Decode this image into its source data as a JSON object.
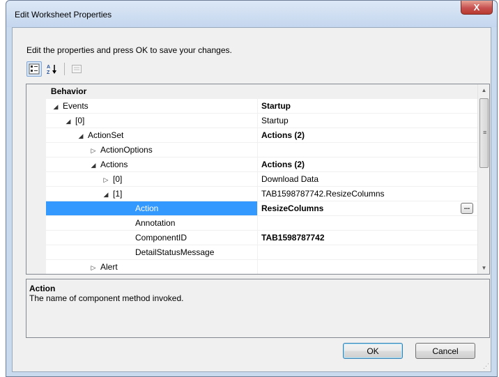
{
  "window": {
    "title": "Edit Worksheet Properties",
    "close_label": "X"
  },
  "instruction": "Edit the properties and press OK to save your changes.",
  "toolbar": {
    "categorized_icon": "categorized-icon",
    "alphabetical_icon": "alphabetical-icon",
    "alphabetical_label": "A↓Z",
    "property_pages_icon": "property-pages-icon"
  },
  "grid": {
    "rows": [
      {
        "name": "Behavior",
        "value": "",
        "glyph": "◢",
        "bold_name": true,
        "category": true
      },
      {
        "name": "Events",
        "value": "Startup",
        "glyph": "◢",
        "bold_value": true
      },
      {
        "name": "[0]",
        "value": "Startup",
        "glyph": "◢"
      },
      {
        "name": "ActionSet",
        "value": "Actions (2)",
        "glyph": "◢",
        "bold_value": true
      },
      {
        "name": "ActionOptions",
        "value": "",
        "glyph": "▷"
      },
      {
        "name": "Actions",
        "value": "Actions (2)",
        "glyph": "◢",
        "bold_value": true
      },
      {
        "name": "[0]",
        "value": "Download Data",
        "glyph": "▷"
      },
      {
        "name": "[1]",
        "value": "TAB1598787742.ResizeColumns",
        "glyph": "◢"
      },
      {
        "name": "Action",
        "value": "ResizeColumns",
        "glyph": "",
        "bold_value": true,
        "selected": true,
        "ellipsis": "..."
      },
      {
        "name": "Annotation",
        "value": "",
        "glyph": ""
      },
      {
        "name": "ComponentID",
        "value": "TAB1598787742",
        "glyph": "",
        "bold_value": true
      },
      {
        "name": "DetailStatusMessage",
        "value": "",
        "glyph": ""
      },
      {
        "name": "Alert",
        "value": "",
        "glyph": "▷"
      }
    ]
  },
  "description": {
    "title": "Action",
    "text": "The name of component method invoked."
  },
  "buttons": {
    "ok": "OK",
    "cancel": "Cancel"
  },
  "colors": {
    "selection": "#3399ff",
    "title_bar": "#c4d6ee",
    "close_button": "#c75050"
  }
}
